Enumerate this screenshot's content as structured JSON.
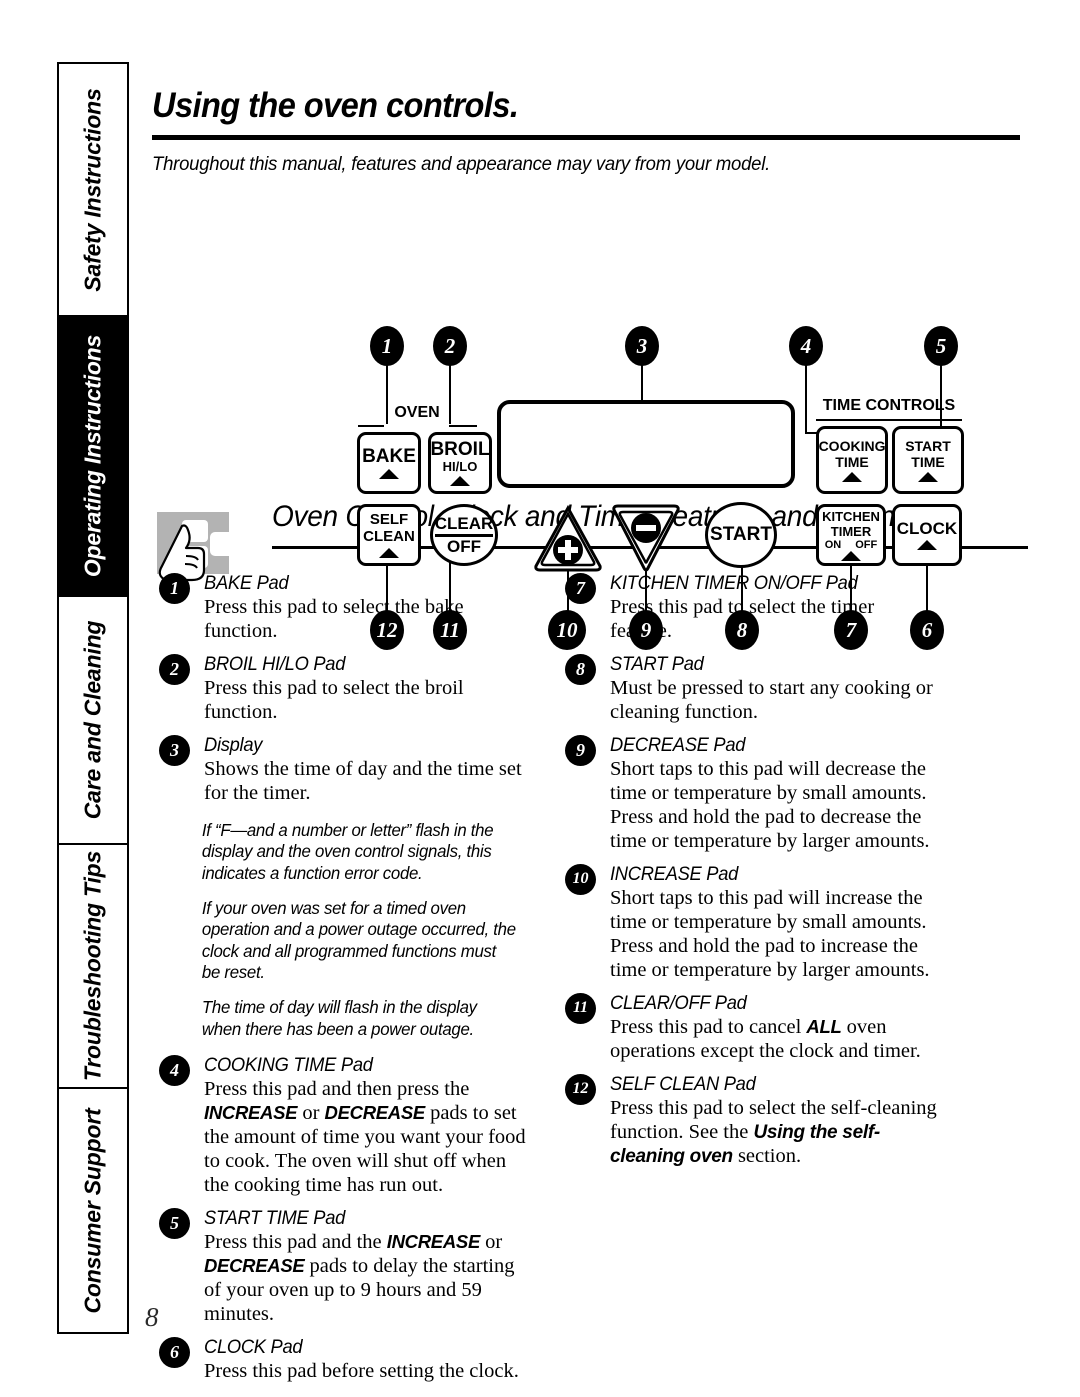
{
  "page": {
    "number": "8",
    "title": "Using the oven controls.",
    "subtitle": "Throughout this manual, features and appearance may vary from your model."
  },
  "side_rail": {
    "tabs": [
      {
        "label": "Safety Instructions",
        "active": false
      },
      {
        "label": "Operating Instructions",
        "active": true
      },
      {
        "label": "Care and Cleaning",
        "active": false
      },
      {
        "label": "Troubleshooting Tips",
        "active": false
      },
      {
        "label": "Consumer Support",
        "active": false
      }
    ]
  },
  "panel": {
    "group_oven": "OVEN",
    "group_time_controls": "TIME CONTROLS",
    "pads": {
      "bake": "BAKE",
      "broil_l1": "BROIL",
      "broil_l2": "HI/LO",
      "self_l1": "SELF",
      "self_l2": "CLEAN",
      "clear": "CLEAR",
      "off": "OFF",
      "cooking_l1": "COOKING",
      "cooking_l2": "TIME",
      "start_time_l1": "START",
      "start_time_l2": "TIME",
      "kitchen_l1": "KITCHEN",
      "kitchen_l2": "TIMER",
      "kitchen_on": "ON",
      "kitchen_off": "OFF",
      "clock": "CLOCK",
      "start": "START"
    },
    "callouts": [
      "1",
      "2",
      "3",
      "4",
      "5",
      "6",
      "7",
      "8",
      "9",
      "10",
      "11",
      "12"
    ]
  },
  "section": {
    "heading": "Oven Control, Clock and Timer Features and Settings",
    "icon": "hand-pointing-icon"
  },
  "left_column": {
    "items": [
      {
        "num": "1",
        "title": "BAKE Pad",
        "body": "Press this pad to select the bake function."
      },
      {
        "num": "2",
        "title": "BROIL HI/LO Pad",
        "body": "Press this pad to select the broil function."
      },
      {
        "num": "3",
        "title": "Display",
        "body": "Shows the time of day and the time set for the timer."
      }
    ],
    "notes": [
      "If “F—and a number or letter” flash in the display and the oven control signals, this indicates a function error code.",
      "If your oven was set for a timed oven operation and a power outage occurred, the clock and all programmed functions must be reset.",
      "The time of day will flash in the display when there has been a power outage."
    ],
    "items2": [
      {
        "num": "4",
        "title": "COOKING TIME Pad",
        "body_pre": "Press this pad and then press the ",
        "bold1": "INCREASE",
        "mid1": " or ",
        "bold2": "DECREASE",
        "body_post": " pads to set the amount of time you want your food to cook. The oven will shut off when the cooking time has run out."
      },
      {
        "num": "5",
        "title": "START TIME Pad",
        "body_pre": "Press this pad and the ",
        "bold1": "INCREASE",
        "mid1": " or ",
        "bold2": "DECREASE",
        "body_post": " pads to delay the starting of your oven up to 9 hours and 59 minutes."
      },
      {
        "num": "6",
        "title": "CLOCK Pad",
        "body": "Press this pad before setting the clock."
      }
    ]
  },
  "right_column": {
    "items": [
      {
        "num": "7",
        "title": "KITCHEN TIMER ON/OFF Pad",
        "body": "Press this pad to select the timer feature."
      },
      {
        "num": "8",
        "title": "START Pad",
        "body": "Must be pressed to start any cooking or cleaning function."
      },
      {
        "num": "9",
        "title": "DECREASE Pad",
        "body": "Short taps to this pad will decrease the time or temperature by small amounts. Press and hold the pad to decrease the time or temperature by larger amounts."
      },
      {
        "num": "10",
        "title": "INCREASE Pad",
        "body": "Short taps to this pad will increase the time or temperature by small amounts. Press and hold the pad to increase the time or temperature by larger amounts."
      }
    ],
    "item_clear": {
      "num": "11",
      "title": "CLEAR/OFF Pad",
      "body_pre": "Press this pad to cancel ",
      "bold1": "ALL",
      "body_post": " oven operations except the clock and timer."
    },
    "item_self": {
      "num": "12",
      "title": "SELF CLEAN Pad",
      "body_pre": "Press this pad to select the self-cleaning function. See the ",
      "italic1": "Using the self-cleaning oven",
      "body_post": " section."
    }
  },
  "colors": {
    "ink": "#000000",
    "hand_icon_gray": "#b3b3b3",
    "page_bg": "#ffffff"
  }
}
